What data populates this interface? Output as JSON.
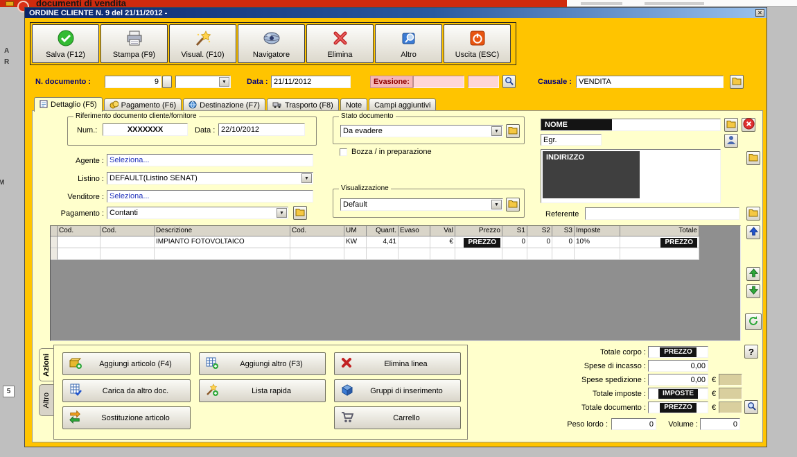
{
  "desktop": {
    "partial_title": "documenti di vendita",
    "left_letters": [
      "A",
      "R",
      "M",
      "5"
    ]
  },
  "window": {
    "title": "ORDINE CLIENTE N. 9  del 21/11/2012 -"
  },
  "icons": {
    "close": "✕",
    "dropdown": "▼",
    "question": "?"
  },
  "toolbar": {
    "buttons": [
      {
        "label": "Salva (F12)",
        "icon": "save-check-icon"
      },
      {
        "label": "Stampa (F9)",
        "icon": "printer-icon"
      },
      {
        "label": "Visual. (F10)",
        "icon": "magic-wand-icon"
      },
      {
        "label": "Navigatore",
        "icon": "navigator-sphere-icon"
      },
      {
        "label": "Elimina",
        "icon": "delete-x-icon"
      },
      {
        "label": "Altro",
        "icon": "other-magnifier-icon"
      },
      {
        "label": "Uscita (ESC)",
        "icon": "exit-power-icon"
      }
    ]
  },
  "docheader": {
    "n_documento_label": "N. documento :",
    "n_documento_value": "9",
    "data_label": "Data :",
    "data_value": "21/11/2012",
    "evasione_label": "Evasione:",
    "evasione_value": "",
    "causale_label": "Causale :",
    "causale_value": "VENDITA"
  },
  "tabs": [
    {
      "label": "Dettaglio (F5)",
      "icon": "detail-form-icon",
      "active": true
    },
    {
      "label": "Pagamento (F6)",
      "icon": "payment-coins-icon",
      "active": false
    },
    {
      "label": "Destinazione (F7)",
      "icon": "destination-globe-icon",
      "active": false
    },
    {
      "label": "Trasporto (F8)",
      "icon": "transport-truck-icon",
      "active": false
    },
    {
      "label": "Note",
      "icon": "",
      "active": false
    },
    {
      "label": "Campi aggiuntivi",
      "icon": "",
      "active": false
    }
  ],
  "detail": {
    "rif_group_title": "Riferimento documento cliente/fornitore",
    "num_label": "Num.:",
    "num_value": "XXXXXXX",
    "rif_data_label": "Data :",
    "rif_data_value": "22/10/2012",
    "agente_label": "Agente :",
    "agente_value": "Seleziona...",
    "listino_label": "Listino :",
    "listino_value": "DEFAULT(Listino SENAT)",
    "venditore_label": "Venditore :",
    "venditore_value": "Seleziona...",
    "pagamento_label": "Pagamento :",
    "pagamento_value": "Contanti",
    "stato_group_title": "Stato documento",
    "stato_value": "Da evadere",
    "bozza_label": "Bozza / in preparazione",
    "vis_group_title": "Visualizzazione",
    "vis_value": "Default",
    "nome_redacted": "NOME",
    "egr_value": "Egr.",
    "indirizzo_redacted": "INDIRIZZO",
    "referente_label": "Referente"
  },
  "grid": {
    "columns": [
      "Cod.",
      "Cod.",
      "Descrizione",
      "Cod.",
      "UM",
      "Quant.",
      "Evaso",
      "Val",
      "Prezzo",
      "S1",
      "S2",
      "S3",
      "Imposte",
      "Totale"
    ],
    "rows": [
      {
        "cells": [
          "",
          "",
          "IMPIANTO FOTOVOLTAICO",
          "",
          "KW",
          "4,41",
          "",
          "€",
          "PREZZO",
          "0",
          "0",
          "0",
          "10%",
          "PREZZO"
        ],
        "redacted": [
          8,
          13
        ]
      },
      {
        "cells": [
          "",
          "",
          "",
          "",
          "",
          "",
          "",
          "",
          "",
          "",
          "",
          "",
          "",
          ""
        ],
        "redacted": []
      }
    ]
  },
  "actions": {
    "tab_azioni": "Azioni",
    "tab_altro": "Altro",
    "buttons": [
      "Aggiungi articolo (F4)",
      "Aggiungi altro (F3)",
      "Elimina linea",
      "Carica da altro doc.",
      "Lista rapida",
      "Gruppi di inserimento",
      "Sostituzione articolo",
      "Carrello"
    ]
  },
  "totals": {
    "totale_corpo_label": "Totale corpo :",
    "totale_corpo_value": "PREZZO",
    "spese_incasso_label": "Spese di incasso :",
    "spese_incasso_value": "0,00",
    "spese_spedizione_label": "Spese spedizione :",
    "spese_spedizione_value": "0,00",
    "totale_imposte_label": "Totale imposte :",
    "totale_imposte_value": "IMPOSTE",
    "totale_documento_label": "Totale documento :",
    "totale_documento_value": "PREZZO",
    "euro": "€",
    "peso_lordo_label": "Peso lordo :",
    "peso_lordo_value": "0",
    "volume_label": "Volume :",
    "volume_value": "0"
  }
}
